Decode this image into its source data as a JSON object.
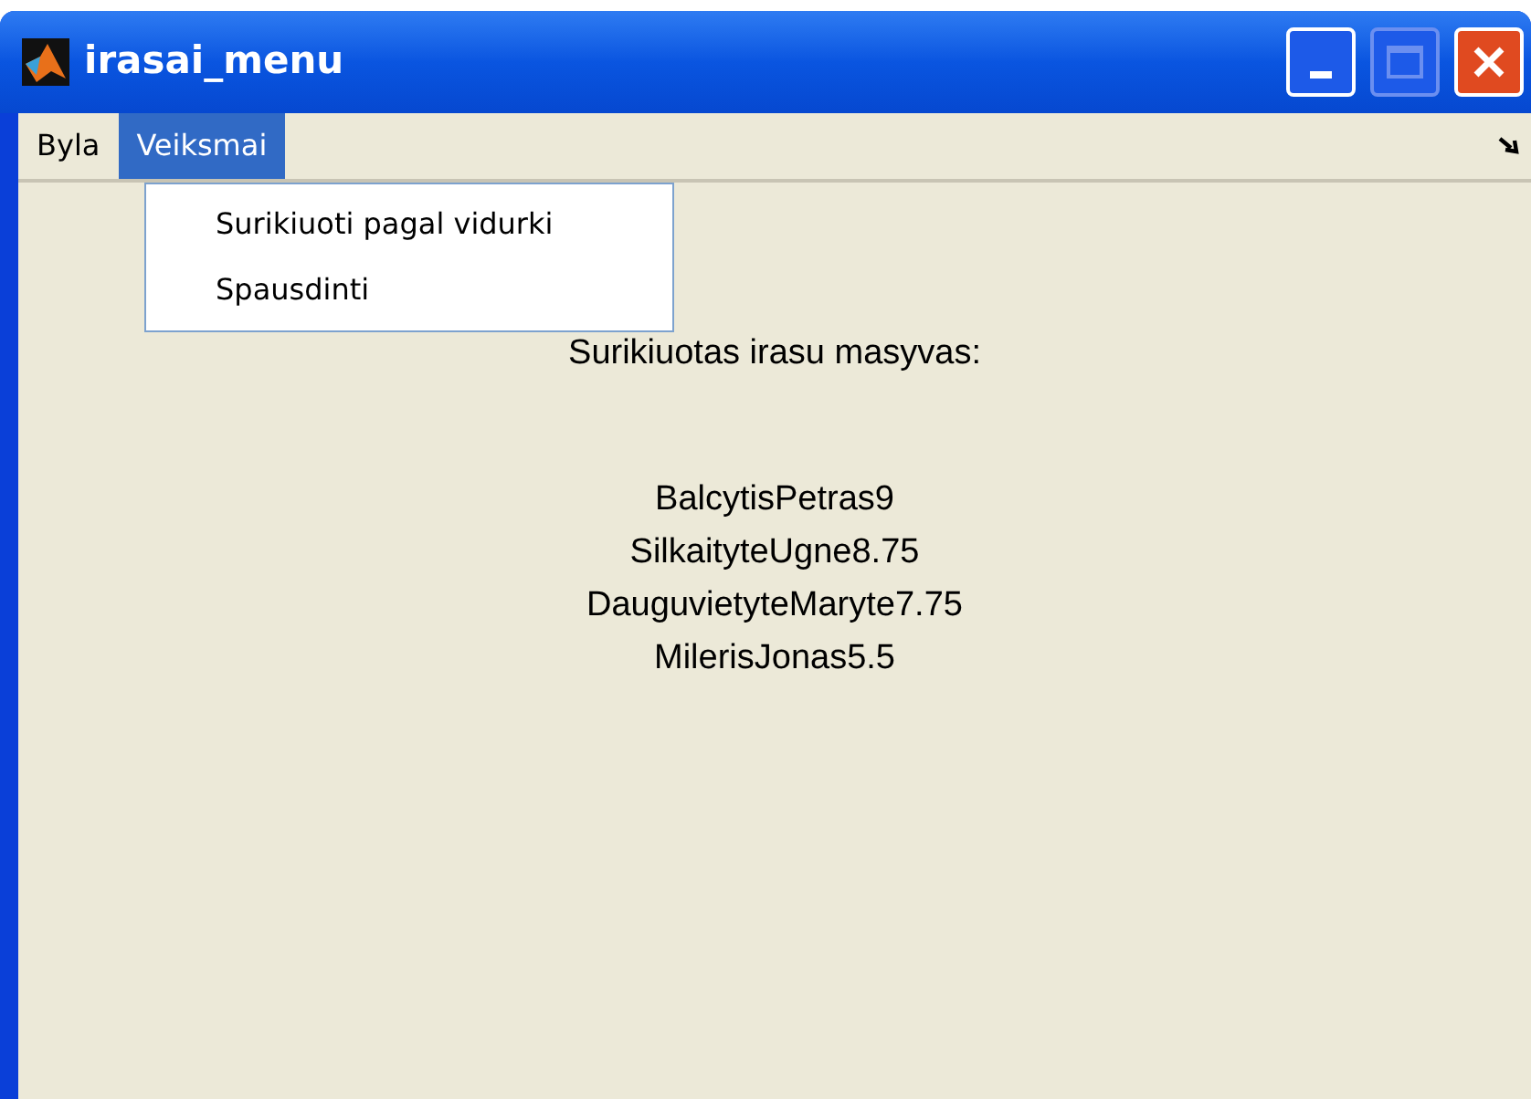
{
  "window": {
    "title": "irasai_menu",
    "maximize_disabled": true
  },
  "menu_bar": [
    {
      "label": "Byla",
      "selected": false
    },
    {
      "label": "Veiksmai",
      "selected": true
    }
  ],
  "dropdown": {
    "items": [
      {
        "label": "Surikiuoti pagal vidurki"
      },
      {
        "label": "Spausdinti"
      }
    ]
  },
  "content": {
    "heading": "Surikiuotas irasu masyvas:",
    "lines": [
      "BalcytisPetras9",
      "SilkaityteUgne8.75",
      "DauguvietyteMaryte7.75",
      "MilerisJonas5.5"
    ]
  }
}
